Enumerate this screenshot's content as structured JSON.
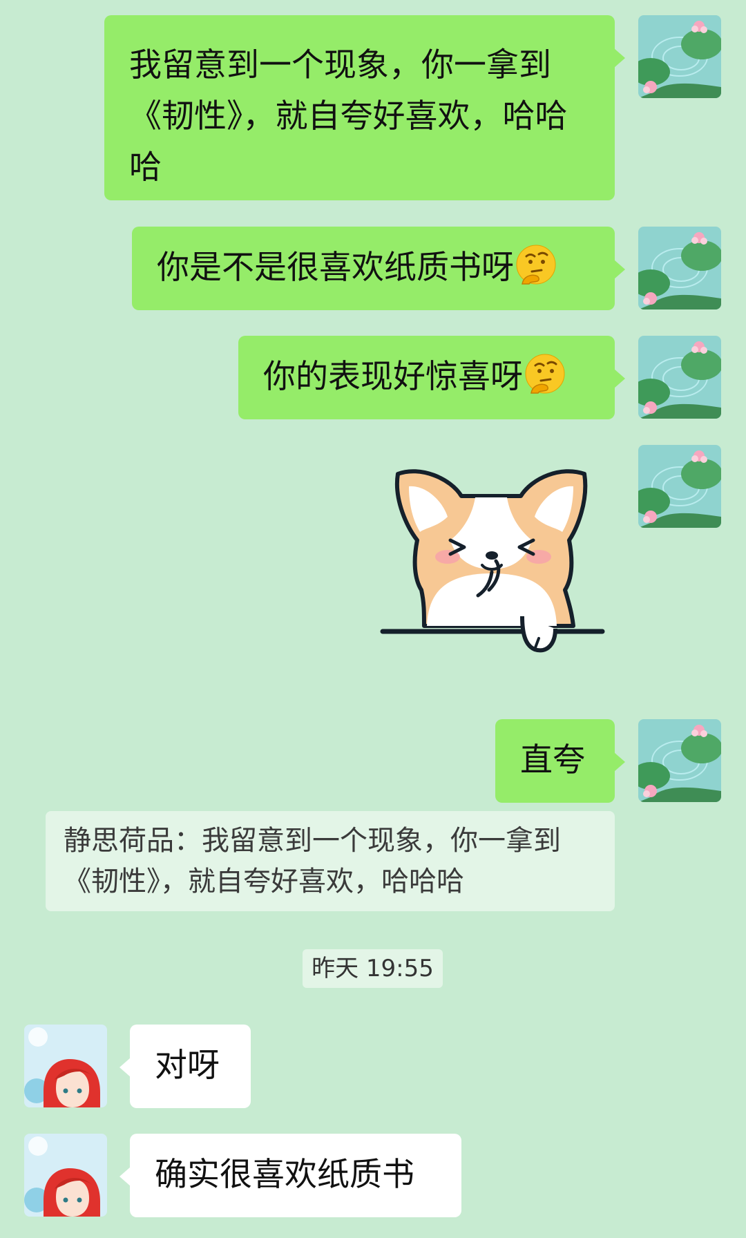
{
  "messages": [
    {
      "text": "我留意到一个现象，你一拿到《韧性》，就自夸好喜欢，哈哈哈"
    },
    {
      "text": "你是不是很喜欢纸质书呀",
      "emoji": "thinking-face-emoji"
    },
    {
      "text": "你的表现好惊喜呀",
      "emoji": "thinking-face-emoji"
    },
    {
      "sticker": "corgi-thinking-sticker"
    },
    {
      "text": "直夸"
    }
  ],
  "quote": {
    "sender": "静思荷品",
    "separator": "：",
    "text": "我留意到一个现象，你一拿到《韧性》，就自夸好喜欢，哈哈哈"
  },
  "timestamp": "昨天 19:55",
  "replies": [
    {
      "text": "对呀"
    },
    {
      "text": "确实很喜欢纸质书"
    }
  ],
  "colors": {
    "background": "#c7ebd1",
    "sent_bubble": "#95ec69",
    "received_bubble": "#ffffff"
  },
  "avatars": {
    "self": "lotus-pond-avatar",
    "other": "red-hair-girl-avatar"
  }
}
